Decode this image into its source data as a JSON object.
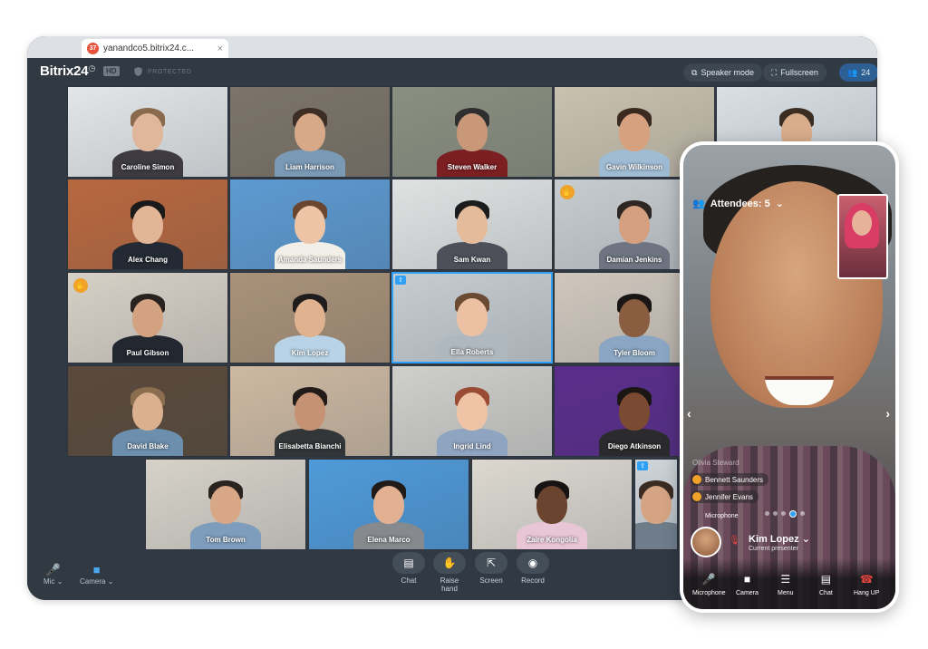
{
  "browser": {
    "tab_badge": "37",
    "tab_title": "yanandco5.bitrix24.c...",
    "tab_close": "×"
  },
  "app": {
    "logo": "Bitrix24",
    "logo_mark": "◷",
    "hd_badge": "HD",
    "protected_label": "PROTECTED",
    "speaker_mode_label": "Speaker mode",
    "fullscreen_label": "Fullscreen",
    "participants_count": "24"
  },
  "participants": [
    {
      "name": "Caroline Simon",
      "bg": "#e3e6e8",
      "skin": "#e0b79a",
      "hair": "#8a6a4c",
      "shirt": "#3d3b3f"
    },
    {
      "name": "Liam Harrison",
      "bg": "#7c7468",
      "skin": "#d8a988",
      "hair": "#3d2e25",
      "shirt": "#7a99b5"
    },
    {
      "name": "Steven Walker",
      "bg": "#8b8f80",
      "skin": "#c89878",
      "hair": "#2f2f30",
      "shirt": "#7c1f22"
    },
    {
      "name": "Gavin Wilkinson",
      "bg": "#c9c1ae",
      "skin": "#d6a17f",
      "hair": "#3a2a1f",
      "shirt": "#9fbcd4"
    },
    {
      "name": "",
      "bg": "#d8e0e5",
      "skin": "#d9ac8c",
      "hair": "#3b2d22",
      "shirt": "#1e2126"
    },
    {
      "name": "Alex Chang",
      "bg": "#b8683f",
      "skin": "#e2b597",
      "hair": "#1b1a1a",
      "shirt": "#242a33"
    },
    {
      "name": "Amanda Saunders",
      "bg": "#5d9ad1",
      "skin": "#edc4a6",
      "hair": "#6a4630",
      "shirt": "#f2efe8"
    },
    {
      "name": "Sam Kwan",
      "bg": "#e0e2e2",
      "skin": "#e4bb9b",
      "hair": "#1c1c1d",
      "shirt": "#4d5059"
    },
    {
      "name": "Damian Jenkins",
      "bg": "#c6cccf",
      "skin": "#d4a07f",
      "hair": "#2e2622",
      "shirt": "#6e7481"
    },
    {
      "name": "Paul Gibson",
      "bg": "#d6d0c6",
      "skin": "#d3a281",
      "hair": "#2a221e",
      "shirt": "#232830"
    },
    {
      "name": "Kim Lopez",
      "bg": "#a99279",
      "skin": "#e1b290",
      "hair": "#1e1c1c",
      "shirt": "#b8d3e6"
    },
    {
      "name": "Ella Roberts",
      "bg": "#c5cdd2",
      "skin": "#ecc0a2",
      "hair": "#6b4a33",
      "shirt": "#b0b8bf"
    },
    {
      "name": "Tyler Bloom",
      "bg": "#cfc7bd",
      "skin": "#8a5d41",
      "hair": "#1a1615",
      "shirt": "#8aa6c2"
    },
    {
      "name": "David Blake",
      "bg": "#5b4a3b",
      "skin": "#dbb08e",
      "hair": "#8a6e4f",
      "shirt": "#6d8fae"
    },
    {
      "name": "Elisabetta Bianchi",
      "bg": "#cdb9a2",
      "skin": "#c69274",
      "hair": "#231b18",
      "shirt": "#333638"
    },
    {
      "name": "Ingrid Lind",
      "bg": "#cfcfcb",
      "skin": "#efc4a6",
      "hair": "#9a4b34",
      "shirt": "#8fa4c1"
    },
    {
      "name": "Diego Atkinson",
      "bg": "#5a2d8c",
      "skin": "#7a4a33",
      "hair": "#1b1614",
      "shirt": "#2b2b2d"
    },
    {
      "name": "Tom Brown",
      "bg": "#d6d2c9",
      "skin": "#d8a786",
      "hair": "#2b231f",
      "shirt": "#7e9dbd"
    },
    {
      "name": "Elena Marco",
      "bg": "#4f9ad9",
      "skin": "#e2b194",
      "hair": "#201a18",
      "shirt": "#868a8e"
    },
    {
      "name": "Zaire Kongolia",
      "bg": "#dcd8d0",
      "skin": "#6b4430",
      "hair": "#161413",
      "shirt": "#e9c6d6"
    },
    {
      "name": "",
      "bg": "#cfd5da",
      "skin": "#d5a483",
      "hair": "#3a2c23",
      "shirt": "#6f7d8b"
    }
  ],
  "bottom": {
    "mic_label": "Mic",
    "camera_label": "Camera",
    "chat_label": "Chat",
    "raise_hand_label": "Raise hand",
    "screen_label": "Screen",
    "record_label": "Record"
  },
  "phone": {
    "attendees_label": "Attendees: 5",
    "speakers": [
      "Olivia Steward",
      "Bennett Saunders",
      "Jennifer Evans"
    ],
    "microphone_hint": "Microphone",
    "presenter_name": "Kim Lopez",
    "presenter_sub": "Current presenter",
    "btn_microphone": "Microphone",
    "btn_camera": "Camera",
    "btn_menu": "Menu",
    "btn_chat": "Chat",
    "btn_hangup": "Hang UP"
  },
  "colors": {
    "accent": "#2fa0f3",
    "hand_badge": "#f0a229",
    "hangup": "#e2453d",
    "app_bg": "#313943"
  }
}
